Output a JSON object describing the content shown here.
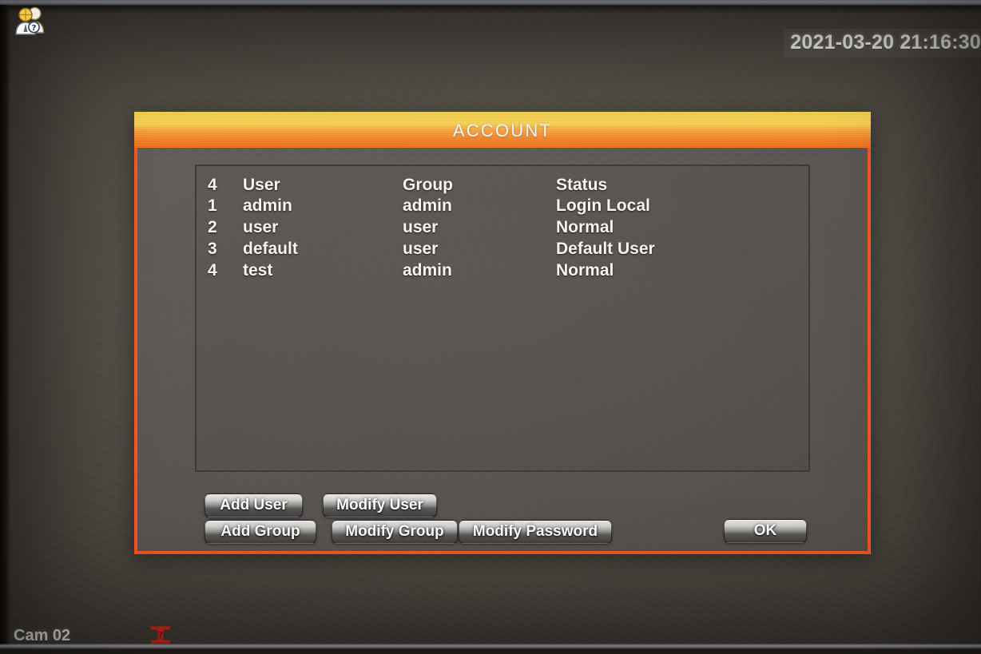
{
  "osd": {
    "timestamp": "2021-03-20 21:16:30",
    "camera_label": "Cam 02",
    "record_icon": "record-indicator-icon"
  },
  "dialog": {
    "title": "ACCOUNT",
    "title_icon": "users-account-icon",
    "accent_color": "#f2561f",
    "titlebar_gradient": [
      "#fbd14a",
      "#f36c16"
    ],
    "body_color": "#585350"
  },
  "table": {
    "columns": [
      "4",
      "User",
      "Group",
      "Status"
    ],
    "header": {
      "index": "4",
      "user": "User",
      "group": "Group",
      "status": "Status"
    },
    "rows": [
      {
        "index": "1",
        "user": "admin",
        "group": "admin",
        "status": "Login Local"
      },
      {
        "index": "2",
        "user": "user",
        "group": "user",
        "status": "Normal"
      },
      {
        "index": "3",
        "user": "default",
        "group": "user",
        "status": "Default User"
      },
      {
        "index": "4",
        "user": "test",
        "group": "admin",
        "status": "Normal"
      }
    ]
  },
  "buttons": {
    "add_user": "Add User",
    "modify_user": "Modify User",
    "add_group": "Add Group",
    "modify_group": "Modify Group",
    "modify_password": "Modify Password",
    "ok": "OK"
  }
}
